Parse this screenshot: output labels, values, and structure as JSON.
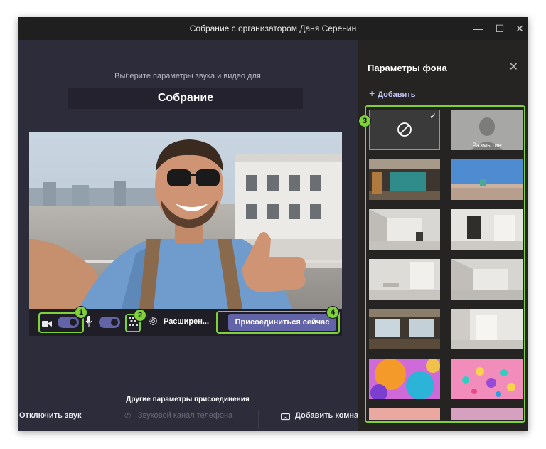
{
  "window": {
    "title": "Собрание с организатором Даня Серенин",
    "minimize_glyph": "—",
    "maximize_glyph": "☐",
    "close_glyph": "✕"
  },
  "prejoin": {
    "prompt": "Выберите параметры звука и видео для",
    "meeting_name": "Собрание"
  },
  "controls": {
    "camera_toggle": "on",
    "mic_toggle": "on",
    "advanced_label": "Расширен...",
    "join_label": "Присоединиться сейчас"
  },
  "badges": [
    "1",
    "2",
    "3",
    "4"
  ],
  "other": {
    "heading": "Другие параметры присоединения",
    "mute_label": "Отключить звук",
    "phone_label": "Звуковой канал телефона",
    "room_label": "Добавить комна"
  },
  "panel": {
    "title": "Параметры фона",
    "add_label": "Добавить",
    "close_glyph": "✕",
    "blur_label": "Размытие"
  },
  "colors": {
    "accent": "#6264a7",
    "highlight": "#7fd13b",
    "panel_bg": "#252423",
    "main_bg": "#2d2c3b"
  }
}
